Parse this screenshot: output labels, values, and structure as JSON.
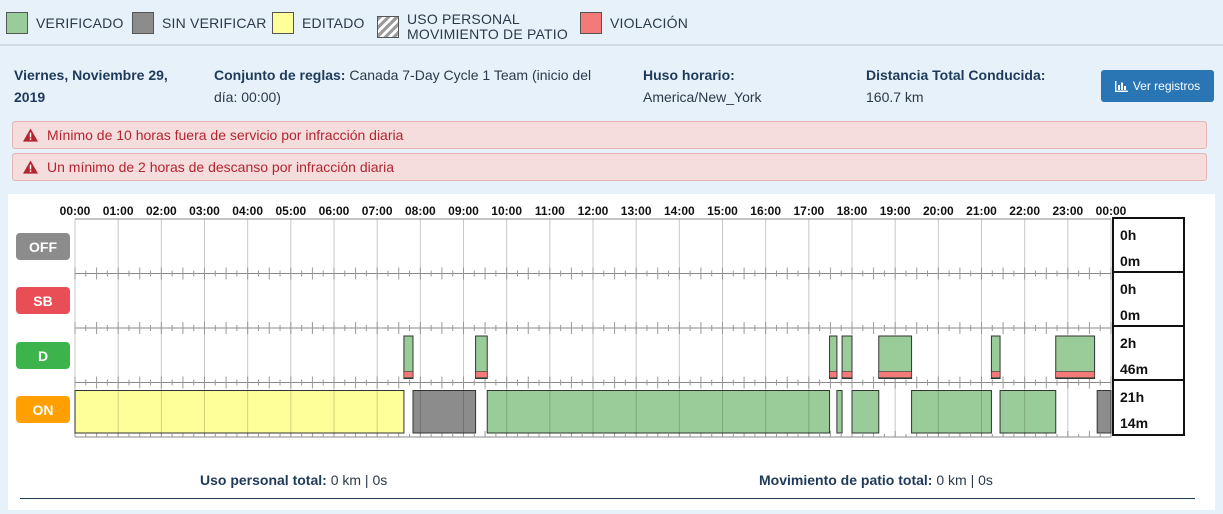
{
  "legend": {
    "verified": "VERIFICADO",
    "unverified": "SIN VERIFICAR",
    "edited": "EDITADO",
    "personal_use_line1": "USO PERSONAL",
    "personal_use_line2": "MOVIMIENTO DE PATIO",
    "violation": "VIOLACIÓN",
    "colors": {
      "verified": "#99cc99",
      "unverified": "#8c8c8c",
      "edited": "#ffff99",
      "violation": "#f47a7a"
    }
  },
  "info": {
    "date_line1": "Viernes, Noviembre 29,",
    "date_line2": "2019",
    "ruleset_label": "Conjunto de reglas:",
    "ruleset_value_line1": "Canada 7-Day Cycle 1 Team (inicio del",
    "ruleset_value_line2": "día: 00:00)",
    "timezone_label": "Huso horario:",
    "timezone_value": "America/New_York",
    "distance_label": "Distancia Total Conducida:",
    "distance_value": "160.7 km",
    "view_logs_button": "Ver registros"
  },
  "alerts": [
    "Mínimo de 10 horas fuera de servicio por infracción diaria",
    "Un mínimo de 2 horas de descanso por infracción diaria"
  ],
  "graph": {
    "hour_labels": [
      "00:00",
      "01:00",
      "02:00",
      "03:00",
      "04:00",
      "05:00",
      "06:00",
      "07:00",
      "08:00",
      "09:00",
      "10:00",
      "11:00",
      "12:00",
      "13:00",
      "14:00",
      "15:00",
      "16:00",
      "17:00",
      "18:00",
      "19:00",
      "20:00",
      "21:00",
      "22:00",
      "23:00",
      "00:00"
    ],
    "statuses": [
      {
        "label": "OFF",
        "color": "#8c8c8c"
      },
      {
        "label": "SB",
        "color": "#e94e56"
      },
      {
        "label": "D",
        "color": "#3cb44b"
      },
      {
        "label": "ON",
        "color": "#ff9f00"
      }
    ],
    "totals": [
      {
        "h": "0h",
        "m": "0m"
      },
      {
        "h": "0h",
        "m": "0m"
      },
      {
        "h": "2h",
        "m": "46m"
      },
      {
        "h": "21h",
        "m": "14m"
      }
    ],
    "segments": [
      {
        "status": "ON",
        "start": 0.0,
        "end": 7.62,
        "kind": "edited"
      },
      {
        "status": "D",
        "start": 7.62,
        "end": 7.83,
        "kind": "verified",
        "violation": true
      },
      {
        "status": "ON",
        "start": 7.83,
        "end": 9.28,
        "kind": "unverified"
      },
      {
        "status": "D",
        "start": 9.28,
        "end": 9.55,
        "kind": "verified",
        "violation": true
      },
      {
        "status": "ON",
        "start": 9.55,
        "end": 17.48,
        "kind": "verified"
      },
      {
        "status": "D",
        "start": 17.48,
        "end": 17.65,
        "kind": "verified",
        "violation": true
      },
      {
        "status": "ON",
        "start": 17.65,
        "end": 17.77,
        "kind": "verified"
      },
      {
        "status": "D",
        "start": 17.77,
        "end": 18.0,
        "kind": "verified",
        "violation": true
      },
      {
        "status": "ON",
        "start": 18.0,
        "end": 18.62,
        "kind": "verified"
      },
      {
        "status": "D",
        "start": 18.62,
        "end": 19.38,
        "kind": "verified",
        "violation": true
      },
      {
        "status": "ON",
        "start": 19.38,
        "end": 21.23,
        "kind": "verified"
      },
      {
        "status": "D",
        "start": 21.23,
        "end": 21.43,
        "kind": "verified",
        "violation": true
      },
      {
        "status": "ON",
        "start": 21.43,
        "end": 22.72,
        "kind": "verified"
      },
      {
        "status": "D",
        "start": 22.72,
        "end": 23.62,
        "kind": "verified",
        "violation": true
      },
      {
        "status": "ON",
        "start": 23.68,
        "end": 24.0,
        "kind": "unverified"
      }
    ]
  },
  "footer": {
    "personal_use_label": "Uso personal total:",
    "personal_use_value": "0 km | 0s",
    "yard_move_label": "Movimiento de patio total:",
    "yard_move_value": "0 km | 0s"
  }
}
